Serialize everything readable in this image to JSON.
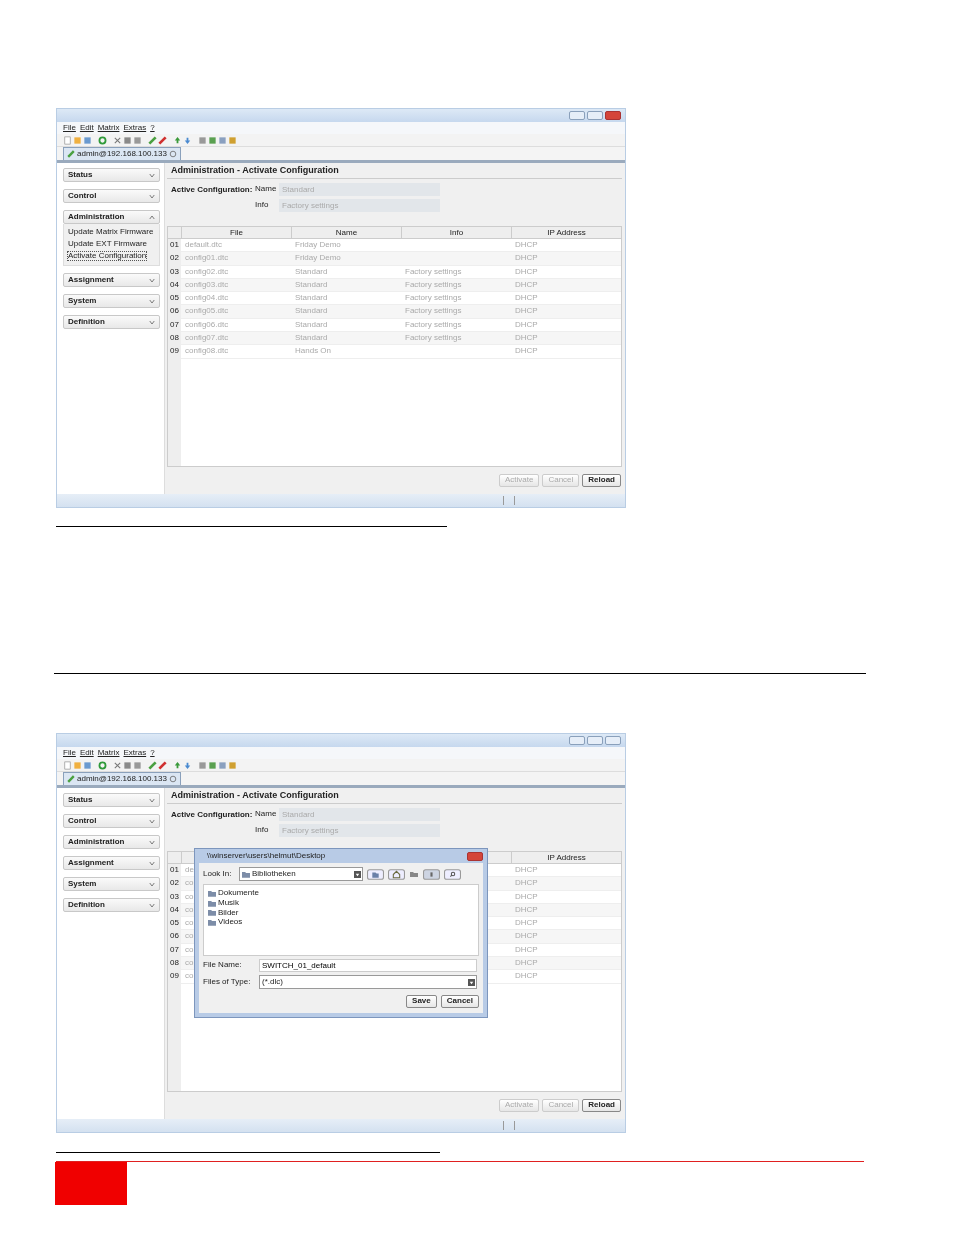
{
  "screens": [
    {
      "window_active": true,
      "menu": [
        "File",
        "Edit",
        "Matrix",
        "Extras",
        "?"
      ],
      "tab": "admin@192.168.100.133",
      "sidebar": [
        {
          "label": "Status",
          "expanded": false
        },
        {
          "label": "Control",
          "expanded": false
        },
        {
          "label": "Administration",
          "expanded": true,
          "children": [
            {
              "label": "Update Matrix Firmware",
              "selected": false
            },
            {
              "label": "Update EXT Firmware",
              "selected": false
            },
            {
              "label": "Activate Configuration",
              "selected": true
            }
          ]
        },
        {
          "label": "Assignment",
          "expanded": false
        },
        {
          "label": "System",
          "expanded": false
        },
        {
          "label": "Definition",
          "expanded": false
        }
      ],
      "panel_title": "Administration - Activate Configuration",
      "active_config": {
        "label": "Active Configuration:",
        "fields": [
          {
            "label": "Name",
            "value": "Standard"
          },
          {
            "label": "Info",
            "value": "Factory settings"
          }
        ]
      },
      "table": {
        "columns": {
          "file": "File",
          "name": "Name",
          "info": "Info",
          "ip": "IP Address"
        },
        "rows": [
          {
            "number": "01",
            "file": "default.dtc",
            "name": "Friday Demo",
            "ip": "DHCP"
          },
          {
            "number": "02",
            "file": "config01.dtc",
            "name": "Friday Demo",
            "ip": "DHCP"
          },
          {
            "number": "03",
            "file": "config02.dtc",
            "name": "Standard",
            "info": "Factory settings",
            "ip": "DHCP"
          },
          {
            "number": "04",
            "file": "config03.dtc",
            "name": "Standard",
            "info": "Factory settings",
            "ip": "DHCP"
          },
          {
            "number": "05",
            "file": "config04.dtc",
            "name": "Standard",
            "info": "Factory settings",
            "ip": "DHCP"
          },
          {
            "number": "06",
            "file": "config05.dtc",
            "name": "Standard",
            "info": "Factory settings",
            "ip": "DHCP"
          },
          {
            "number": "07",
            "file": "config06.dtc",
            "name": "Standard",
            "info": "Factory settings",
            "ip": "DHCP"
          },
          {
            "number": "08",
            "file": "config07.dtc",
            "name": "Standard",
            "info": "Factory settings",
            "ip": "DHCP"
          },
          {
            "number": "09",
            "file": "config08.dtc",
            "name": "Hands On",
            "ip": "DHCP"
          }
        ]
      },
      "buttons": [
        {
          "label": "Activate",
          "disabled": true
        },
        {
          "label": "Cancel",
          "disabled": true
        },
        {
          "label": "Reload",
          "disabled": false
        }
      ]
    },
    {
      "window_active": false,
      "menu": [
        "File",
        "Edit",
        "Matrix",
        "Extras",
        "?"
      ],
      "tab": "admin@192.168.100.133",
      "sidebar": [
        {
          "label": "Status",
          "expanded": false
        },
        {
          "label": "Control",
          "expanded": false
        },
        {
          "label": "Administration",
          "expanded": false
        },
        {
          "label": "Assignment",
          "expanded": false
        },
        {
          "label": "System",
          "expanded": false
        },
        {
          "label": "Definition",
          "expanded": false
        }
      ],
      "panel_title": "Administration - Activate Configuration",
      "active_config": {
        "label": "Active Configuration:",
        "fields": [
          {
            "label": "Name",
            "value": "Standard"
          },
          {
            "label": "Info",
            "value": "Factory settings"
          }
        ]
      },
      "table": {
        "columns": {
          "ip": "IP Address"
        },
        "rows": [
          {
            "number": "01",
            "file": "de",
            "ip": "DHCP"
          },
          {
            "number": "02",
            "file": "co",
            "ip": "DHCP"
          },
          {
            "number": "03",
            "file": "co",
            "ip": "DHCP"
          },
          {
            "number": "04",
            "file": "co",
            "ip": "DHCP"
          },
          {
            "number": "05",
            "file": "co",
            "ip": "DHCP"
          },
          {
            "number": "06",
            "file": "co",
            "ip": "DHCP"
          },
          {
            "number": "07",
            "file": "co",
            "ip": "DHCP"
          },
          {
            "number": "08",
            "file": "co",
            "ip": "DHCP"
          },
          {
            "number": "09",
            "file": "co",
            "ip": "DHCP"
          }
        ]
      },
      "buttons": [
        {
          "label": "Activate",
          "disabled": true
        },
        {
          "label": "Cancel",
          "disabled": true
        },
        {
          "label": "Reload",
          "disabled": false
        }
      ],
      "dialog": {
        "title": "\\\\winserver\\users\\helmut\\Desktop",
        "look_in_label": "Look In:",
        "look_in": "Bibliotheken",
        "items": [
          "Dokumente",
          "Musik",
          "Bilder",
          "Videos"
        ],
        "file_name_label": "File Name:",
        "file_name": "SWITCH_01_default",
        "type_label": "Files of Type:",
        "type": "(*.dlc)",
        "buttons": [
          "Save",
          "Cancel"
        ]
      }
    }
  ]
}
